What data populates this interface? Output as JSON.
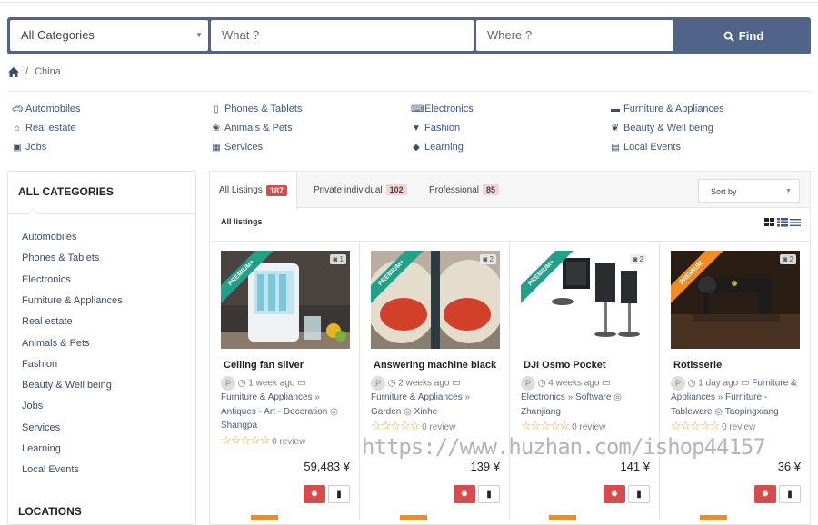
{
  "search": {
    "category": "All Categories",
    "what_placeholder": "What ?",
    "where_placeholder": "Where ?",
    "find_label": "Find"
  },
  "breadcrumb": {
    "current": "China"
  },
  "categories": [
    {
      "label": "Automobiles",
      "icon": "car-icon"
    },
    {
      "label": "Phones & Tablets",
      "icon": "mobile-icon"
    },
    {
      "label": "Electronics",
      "icon": "laptop-icon"
    },
    {
      "label": "Furniture & Appliances",
      "icon": "sofa-icon"
    },
    {
      "label": "Real estate",
      "icon": "home-icon"
    },
    {
      "label": "Animals & Pets",
      "icon": "paw-icon"
    },
    {
      "label": "Fashion",
      "icon": "shirt-icon"
    },
    {
      "label": "Beauty & Well being",
      "icon": "lotus-icon"
    },
    {
      "label": "Jobs",
      "icon": "briefcase-icon"
    },
    {
      "label": "Services",
      "icon": "calculator-icon"
    },
    {
      "label": "Learning",
      "icon": "graduation-cap-icon"
    },
    {
      "label": "Local Events",
      "icon": "calendar-icon"
    }
  ],
  "sidebar": {
    "title": "ALL CATEGORIES",
    "items": [
      "Automobiles",
      "Phones & Tablets",
      "Electronics",
      "Furniture & Appliances",
      "Real estate",
      "Animals & Pets",
      "Fashion",
      "Beauty & Well being",
      "Jobs",
      "Services",
      "Learning",
      "Local Events"
    ],
    "locations_title": "LOCATIONS"
  },
  "tabs": [
    {
      "label": "All Listings",
      "count": "187"
    },
    {
      "label": "Private individual",
      "count": "102"
    },
    {
      "label": "Professional",
      "count": "85"
    }
  ],
  "sort_label": "Sort by",
  "listings_heading": "All listings",
  "cards": [
    {
      "title": "Ceiling fan silver",
      "ribbon": "PREMIUM+",
      "photos": "1",
      "avatar": "P",
      "time": "1 week ago",
      "cat1": "Furniture & Appliances",
      "cat2": "Antiques - Art - Decoration",
      "location": "Shangpa",
      "review": "0 review",
      "price": "59,483 ¥"
    },
    {
      "title": "Answering machine black",
      "ribbon": "PREMIUM+",
      "photos": "2",
      "avatar": "P",
      "time": "2 weeks ago",
      "cat1": "Furniture & Appliances",
      "cat2": "Garden",
      "location": "Xinhe",
      "review": "0 review",
      "price": "139 ¥"
    },
    {
      "title": "DJI Osmo Pocket",
      "ribbon": "PREMIUM+",
      "photos": "2",
      "avatar": "P",
      "time": "4 weeks ago",
      "cat1": "Electronics",
      "cat2": "Software",
      "location": "Zhanjiang",
      "review": "0 review",
      "price": "141 ¥"
    },
    {
      "title": "Rotisserie",
      "ribbon": "PREMIUM",
      "photos": "2",
      "avatar": "P",
      "time": "1 day ago",
      "cat1": "Furniture & Appliances",
      "cat2": "Furniture - Tableware",
      "location": "Taopingxiang",
      "review": "0 review",
      "price": "36 ¥"
    }
  ],
  "watermark": "https://www.huzhan.com/ishop44157",
  "colors": {
    "header": "#4f6488",
    "badge_red": "#d64c4c",
    "premium_plus": "#23a08a",
    "premium": "#ef8c24",
    "star": "#f2a41c"
  }
}
